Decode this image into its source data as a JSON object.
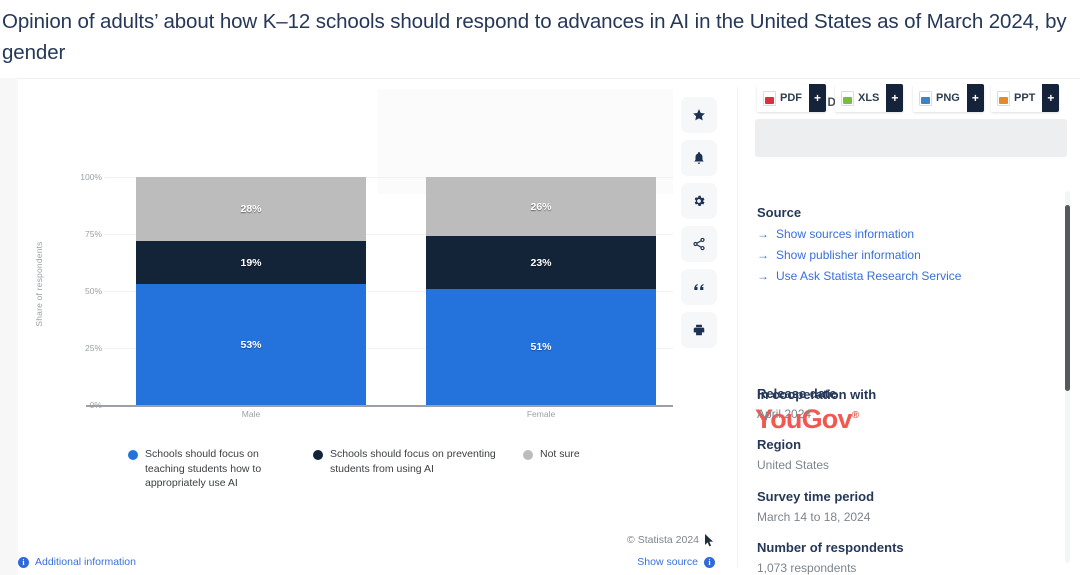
{
  "title": "Opinion of adults’ about how K–12 schools should respond to advances in AI in the United States as of March 2024, by gender",
  "chart_data": {
    "type": "bar",
    "subtype": "stacked-100-percent",
    "title": "Opinion of adults’ about how K–12 schools should respond to advances in AI in the United States as of March 2024, by gender",
    "categories": [
      "Male",
      "Female"
    ],
    "series": [
      {
        "name": "Schools should focus on teaching students how to appropriately use AI",
        "color": "#2473dd",
        "values": [
          53,
          51
        ],
        "labels": [
          "53%",
          "51%"
        ]
      },
      {
        "name": "Schools should focus on preventing students from using AI",
        "color": "#132338",
        "values": [
          19,
          23
        ],
        "labels": [
          "19%",
          "23%"
        ]
      },
      {
        "name": "Not sure",
        "color": "#bcbcbc",
        "values": [
          28,
          26
        ],
        "labels": [
          "28%",
          "26%"
        ]
      }
    ],
    "xlabel": "",
    "ylabel": "Share of respondents",
    "ylim": [
      0,
      100
    ],
    "yticks": [
      "0%",
      "25%",
      "50%",
      "75%",
      "100%"
    ],
    "grid": true,
    "legend_position": "bottom"
  },
  "rail": {
    "items": [
      {
        "name": "favorite",
        "icon": "star-icon"
      },
      {
        "name": "notify",
        "icon": "bell-icon"
      },
      {
        "name": "settings",
        "icon": "gear-icon"
      },
      {
        "name": "share",
        "icon": "share-icon"
      },
      {
        "name": "cite",
        "icon": "quote-icon"
      },
      {
        "name": "print",
        "icon": "print-icon"
      }
    ]
  },
  "sidebar": {
    "download_heading": "DOWNLOAD",
    "downloads": [
      {
        "label": "PDF",
        "color": "#d8323c",
        "plus": "+"
      },
      {
        "label": "XLS",
        "color": "#7cbb41",
        "plus": "+"
      },
      {
        "label": "PNG",
        "color": "#3f83c4",
        "plus": "+"
      },
      {
        "label": "PPT",
        "color": "#e08b2e",
        "plus": "+"
      }
    ],
    "source_heading": "Source",
    "source_links": [
      "Show sources information",
      "Show publisher information",
      "Use Ask Statista Research Service"
    ],
    "cooperation_heading": "In cooperation with",
    "cooperation_logo": "YouGov",
    "meta": [
      {
        "label": "Release date",
        "value": "April 2024"
      },
      {
        "label": "Region",
        "value": "United States"
      },
      {
        "label": "Survey time period",
        "value": "March 14 to 18, 2024"
      },
      {
        "label": "Number of respondents",
        "value": "1,073 respondents"
      }
    ]
  },
  "footer": {
    "copyright": "© Statista 2024",
    "additional_information": "Additional information",
    "show_source": "Show source",
    "info_glyph": "i"
  }
}
